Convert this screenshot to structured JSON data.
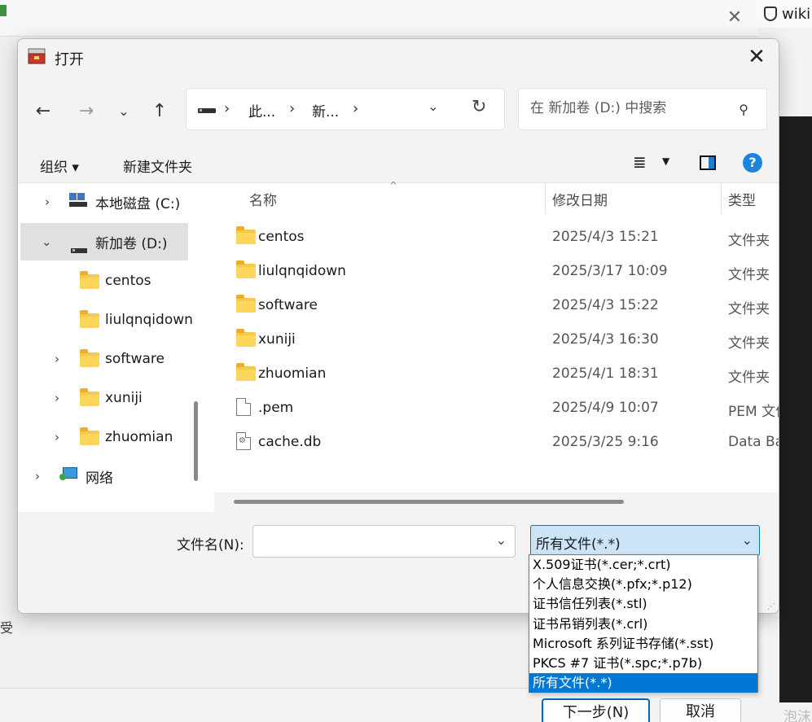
{
  "background": {
    "tab_label": "wiki",
    "next_button": "下一步(N)",
    "cancel_button": "取消",
    "side_text": "受",
    "watermark": "泡沫"
  },
  "dialog": {
    "title": "打开",
    "nav": {
      "back_icon": "arrow-left-icon",
      "forward_icon": "arrow-right-icon",
      "recent_icon": "chevron-down-icon",
      "up_icon": "arrow-up-icon"
    },
    "address": {
      "crumbs": [
        "此...",
        "新..."
      ]
    },
    "search": {
      "placeholder": "在 新加卷 (D:) 中搜索"
    },
    "toolbar": {
      "organize": "组织 ▾",
      "new_folder": "新建文件夹"
    },
    "tree": [
      {
        "label": "本地磁盘 (C:)",
        "icon": "windows-drive-icon",
        "expandable": true
      },
      {
        "label": "新加卷 (D:)",
        "icon": "drive-icon",
        "expanded": true,
        "selected": true
      },
      {
        "label": "centos",
        "icon": "folder-icon"
      },
      {
        "label": "liulqnqidown",
        "icon": "folder-icon"
      },
      {
        "label": "software",
        "icon": "folder-icon",
        "expandable": true
      },
      {
        "label": "xuniji",
        "icon": "folder-icon",
        "expandable": true
      },
      {
        "label": "zhuomian",
        "icon": "folder-icon",
        "expandable": true
      },
      {
        "label": "网络",
        "icon": "network-icon",
        "expandable": true
      }
    ],
    "columns": {
      "name": "名称",
      "date": "修改日期",
      "type": "类型"
    },
    "files": [
      {
        "name": "centos",
        "date": "2025/4/3 15:21",
        "type": "文件夹",
        "icon": "folder-icon"
      },
      {
        "name": "liulqnqidown",
        "date": "2025/3/17 10:09",
        "type": "文件夹",
        "icon": "folder-icon"
      },
      {
        "name": "software",
        "date": "2025/4/3 15:22",
        "type": "文件夹",
        "icon": "folder-icon"
      },
      {
        "name": "xuniji",
        "date": "2025/4/3 16:30",
        "type": "文件夹",
        "icon": "folder-icon"
      },
      {
        "name": "zhuomian",
        "date": "2025/4/1 18:31",
        "type": "文件夹",
        "icon": "folder-icon"
      },
      {
        "name": ".pem",
        "date": "2025/4/9 10:07",
        "type": "PEM 文件",
        "icon": "file-icon"
      },
      {
        "name": "cache.db",
        "date": "2025/3/25 9:16",
        "type": "Data Base",
        "icon": "database-file-icon"
      }
    ],
    "footer": {
      "filename_label": "文件名(N):",
      "filename_value": "",
      "filter_selected": "所有文件(*.*)"
    },
    "filter_options": [
      "X.509证书(*.cer;*.crt)",
      "个人信息交换(*.pfx;*.p12)",
      "证书信任列表(*.stl)",
      "证书吊销列表(*.crl)",
      "Microsoft 系列证书存储(*.sst)",
      "PKCS #7 证书(*.spc;*.p7b)",
      "所有文件(*.*)"
    ]
  }
}
